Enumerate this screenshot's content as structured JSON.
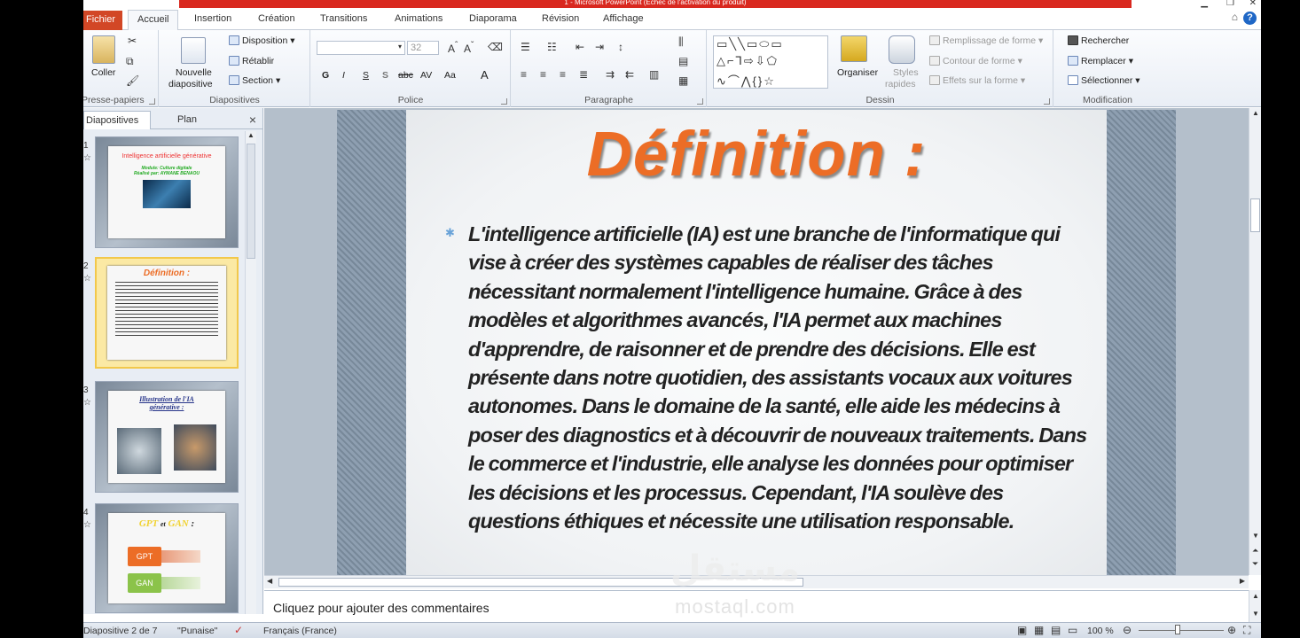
{
  "window": {
    "title": "1 - Microsoft PowerPoint (Échec de l'activation du produit)"
  },
  "ribbon_tabs": [
    "Fichier",
    "Accueil",
    "Insertion",
    "Création",
    "Transitions",
    "Animations",
    "Diaporama",
    "Révision",
    "Affichage"
  ],
  "active_tab": "Accueil",
  "ribbon": {
    "clipboard": {
      "paste": "Coller",
      "label": "Presse-papiers"
    },
    "slides": {
      "new_slide_1": "Nouvelle",
      "new_slide_2": "diapositive",
      "layout": "Disposition",
      "reset": "Rétablir",
      "section": "Section",
      "label": "Diapositives"
    },
    "font": {
      "size": "32",
      "label": "Police",
      "bold": "G",
      "italic": "I",
      "underline": "S",
      "shadow": "S",
      "strike": "abc",
      "spacing": "AV",
      "case": "Aa",
      "color": "A"
    },
    "paragraph": {
      "label": "Paragraphe"
    },
    "drawing": {
      "arrange": "Organiser",
      "styles_1": "Styles",
      "styles_2": "rapides",
      "fill": "Remplissage de forme",
      "outline": "Contour de forme",
      "effects": "Effets sur la forme",
      "label": "Dessin"
    },
    "editing": {
      "find": "Rechercher",
      "replace": "Remplacer",
      "select": "Sélectionner",
      "label": "Modification"
    }
  },
  "left_pane": {
    "tab_slides": "Diapositives",
    "tab_outline": "Plan",
    "close": "×",
    "thumbnails": [
      {
        "num": "1",
        "title": "Intelligence artificielle générative",
        "line1": "Module: Culture digitale",
        "line2": "Réalisé par: AYMANE BENAOU"
      },
      {
        "num": "2",
        "title": "Définition :",
        "selected": true
      },
      {
        "num": "3",
        "title": "Illustration de l'IA générative :"
      },
      {
        "num": "4",
        "title_a": "GPT",
        "title_et": "et",
        "title_b": "GAN",
        "title_colon": ":",
        "box1": "GPT",
        "box2": "GAN"
      }
    ]
  },
  "slide": {
    "title": "Définition :",
    "body": "L'intelligence artificielle (IA) est une branche de l'informatique qui vise à créer des systèmes capables de réaliser des tâches nécessitant normalement l'intelligence humaine. Grâce à des modèles et algorithmes avancés, l'IA permet aux machines d'apprendre, de raisonner et de prendre des décisions. Elle est présente dans notre quotidien, des assistants vocaux aux voitures autonomes. Dans le domaine de la santé, elle aide les médecins à poser des diagnostics et à découvrir de nouveaux traitements. Dans le commerce et l'industrie, elle analyse les données pour optimiser les décisions et les processus. Cependant, l'IA soulève des questions éthiques et nécessite une utilisation responsable."
  },
  "notes_placeholder": "Cliquez pour ajouter des commentaires",
  "status": {
    "slide_counter": "Diapositive 2 de 7",
    "theme": "\"Punaise\"",
    "language": "Français (France)",
    "zoom": "100 %"
  },
  "watermark": {
    "arabic": "مستقل",
    "latin": "mostaql.com"
  },
  "colors": {
    "file_tab": "#d24726",
    "title": "#ec6d26",
    "titlebar": "#d9281f"
  }
}
